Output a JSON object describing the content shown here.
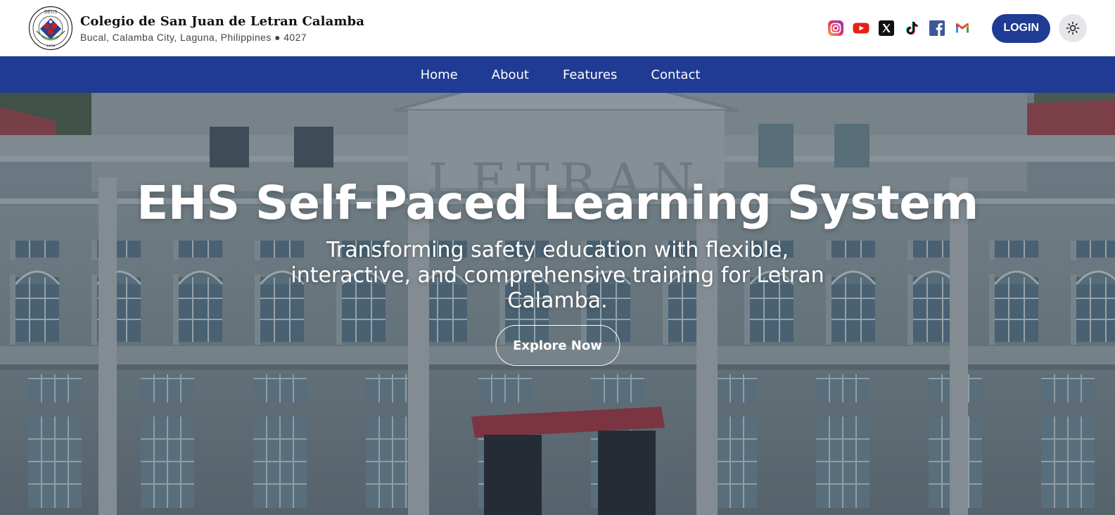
{
  "header": {
    "school_name": "Colegio de San Juan de Letran Calamba",
    "address": "Bucal, Calamba City, Laguna, Philippines ● 4027",
    "seal_text_top": "DEUS",
    "seal_year": "1979",
    "socials": [
      {
        "name": "instagram-icon"
      },
      {
        "name": "youtube-icon"
      },
      {
        "name": "x-icon"
      },
      {
        "name": "tiktok-icon"
      },
      {
        "name": "facebook-icon"
      },
      {
        "name": "gmail-icon"
      }
    ],
    "login_label": "LOGIN",
    "theme_icon": "sun-icon"
  },
  "nav": {
    "items": [
      {
        "label": "Home"
      },
      {
        "label": "About"
      },
      {
        "label": "Features"
      },
      {
        "label": "Contact"
      }
    ]
  },
  "hero": {
    "title": "EHS Self-Paced Learning System",
    "subtitle": "Transforming safety education with flexible, interactive, and comprehensive training for Letran Calamba.",
    "cta_label": "Explore Now",
    "building_sign": "LETRAN"
  },
  "colors": {
    "primary": "#1f3b93",
    "nav_text": "#ffffff",
    "hero_text": "#ffffff"
  }
}
